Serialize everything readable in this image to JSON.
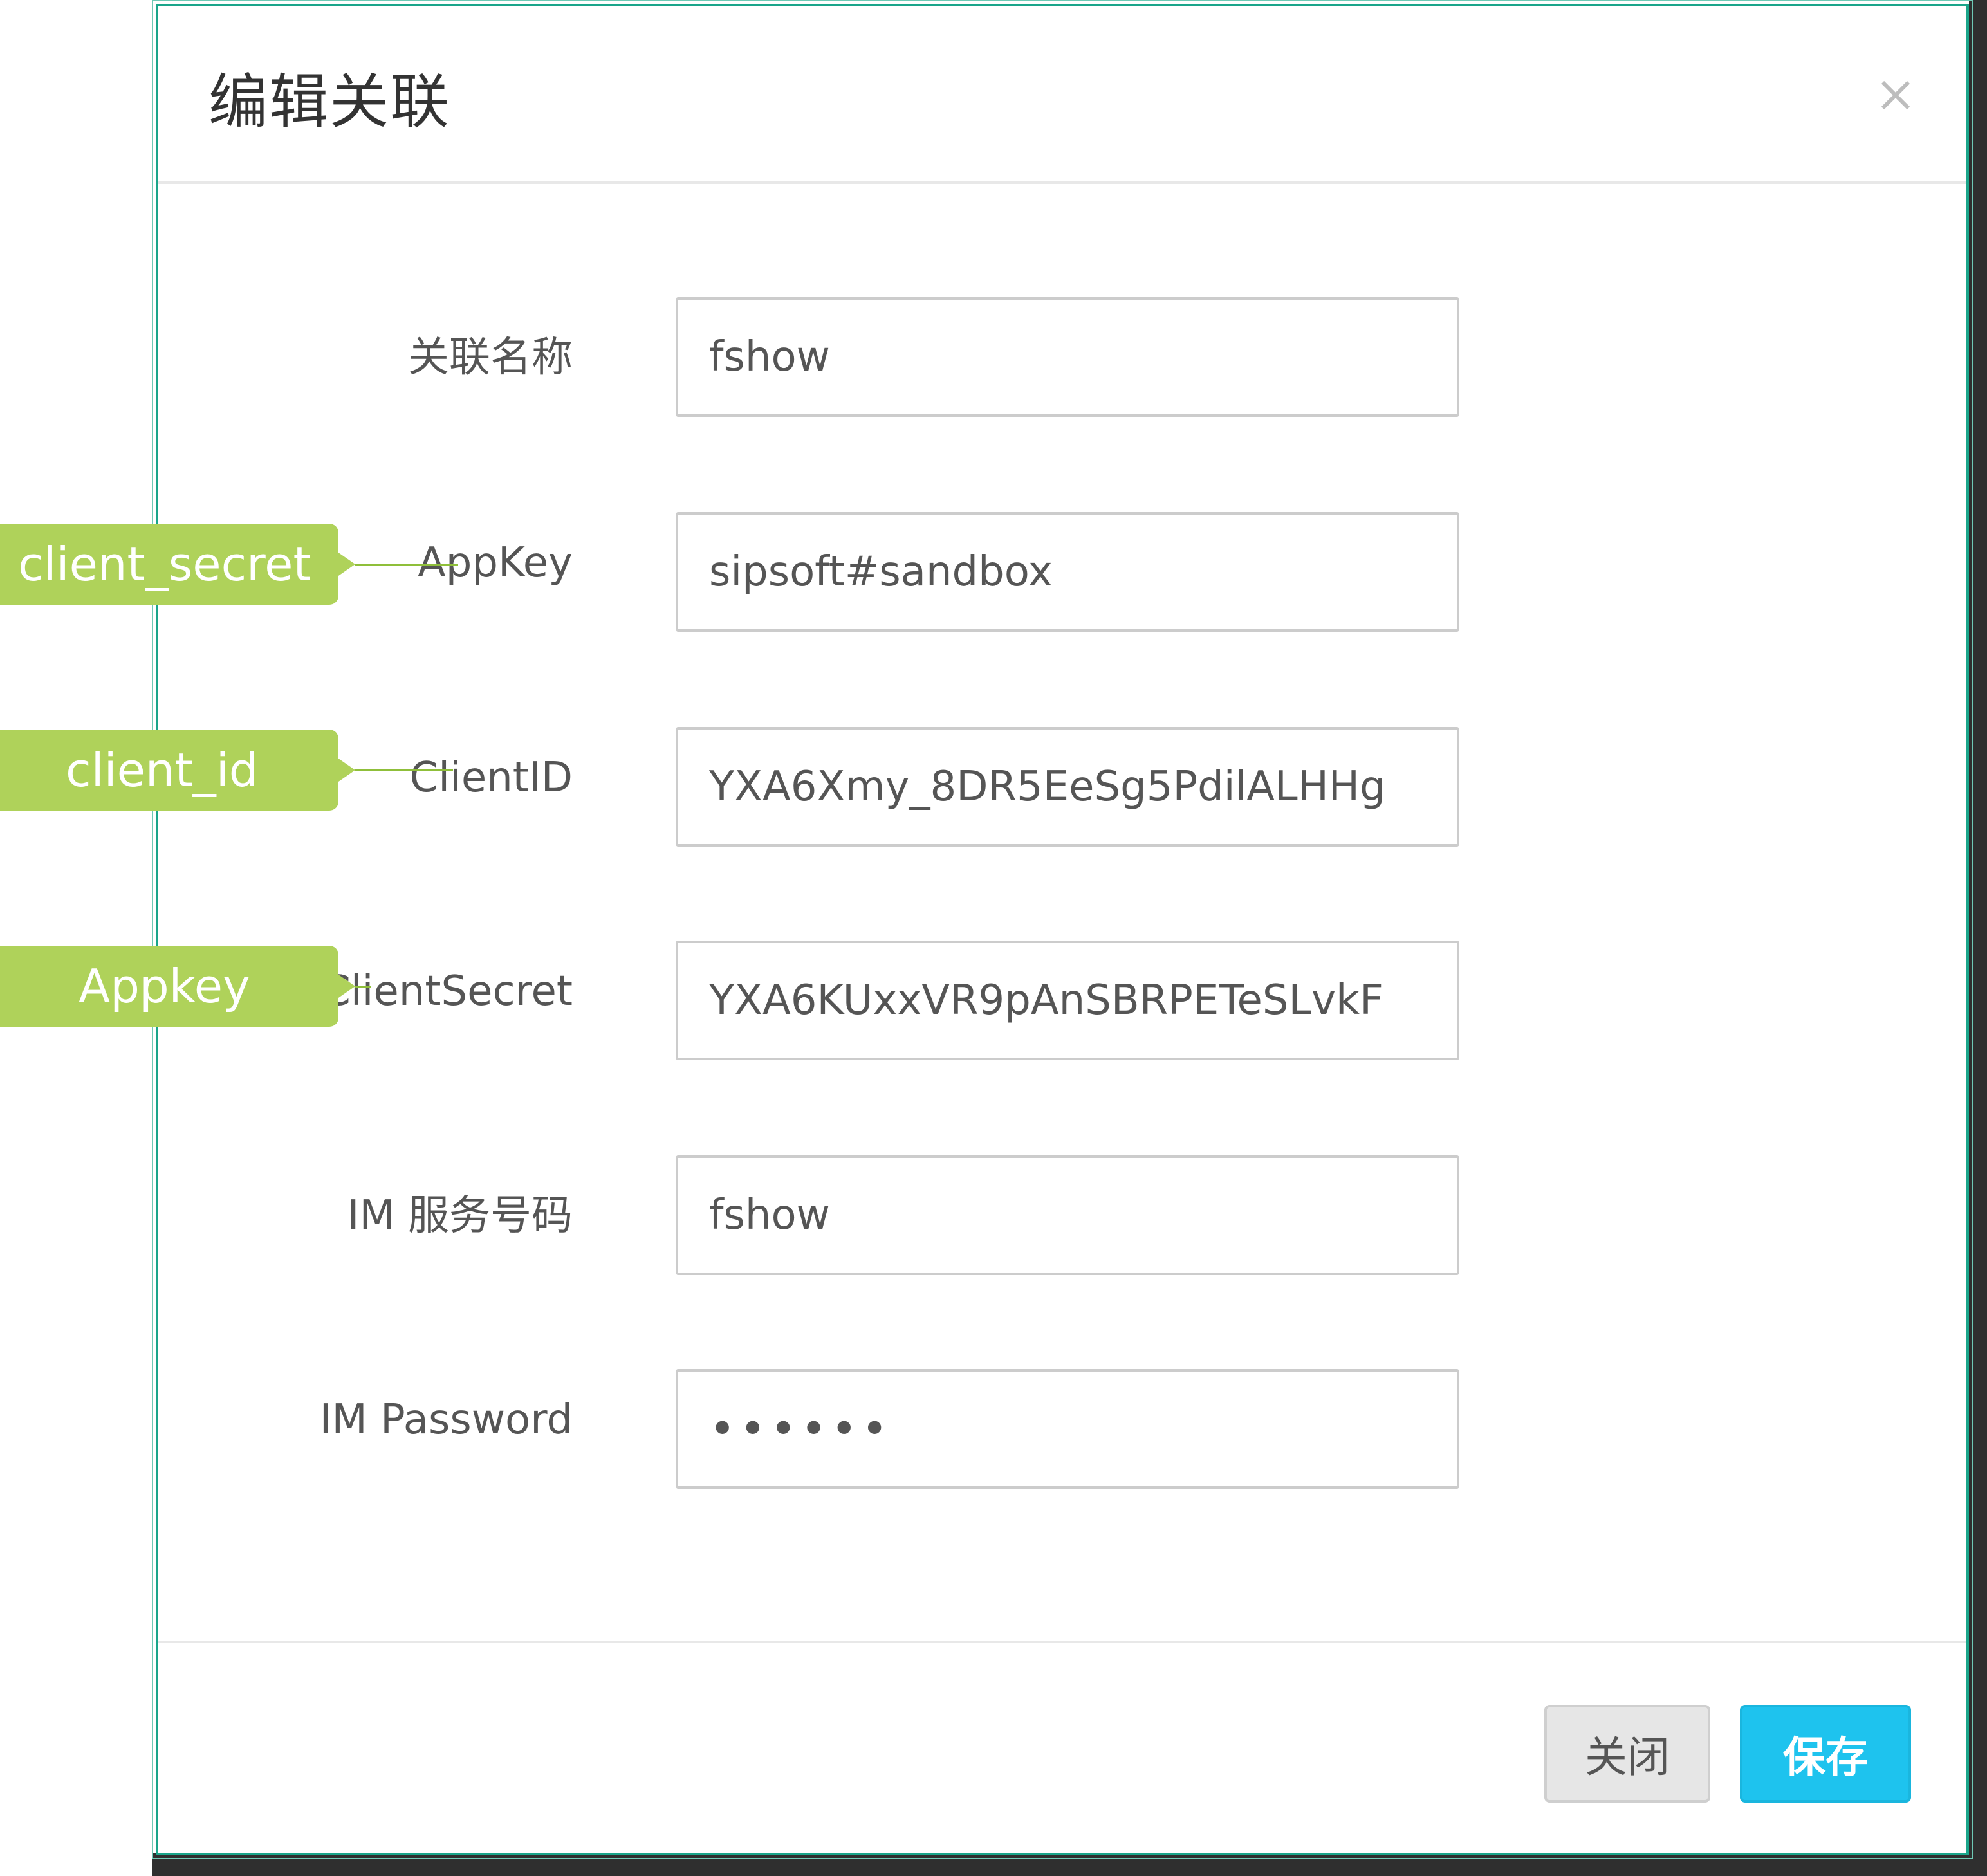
{
  "dialog": {
    "title": "编辑关联",
    "close_icon": "close-icon"
  },
  "form": {
    "fields": [
      {
        "label": "关联名称",
        "value": "fshow"
      },
      {
        "label": "AppKey",
        "value": "sipsoft#sandbox"
      },
      {
        "label": "ClientID",
        "value": "YXA6Xmy_8DR5EeSg5PdilALHHg"
      },
      {
        "label": "ClientSecret",
        "value": "YXA6KUxxVR9pAnSBRPETeSLvkF"
      },
      {
        "label": "IM 服务号码",
        "value": "fshow"
      },
      {
        "label": "IM Password",
        "value": "••••••"
      }
    ]
  },
  "footer": {
    "close_label": "关闭",
    "save_label": "保存"
  },
  "annotations": [
    {
      "text": "client_secret",
      "target": "AppKey"
    },
    {
      "text": "client_id",
      "target": "ClientID"
    },
    {
      "text": "Appkey",
      "target": "ClientSecret"
    }
  ],
  "colors": {
    "modal_border": "#1aa58a",
    "save_button": "#1ec3ee",
    "callout": "#afd25a"
  }
}
